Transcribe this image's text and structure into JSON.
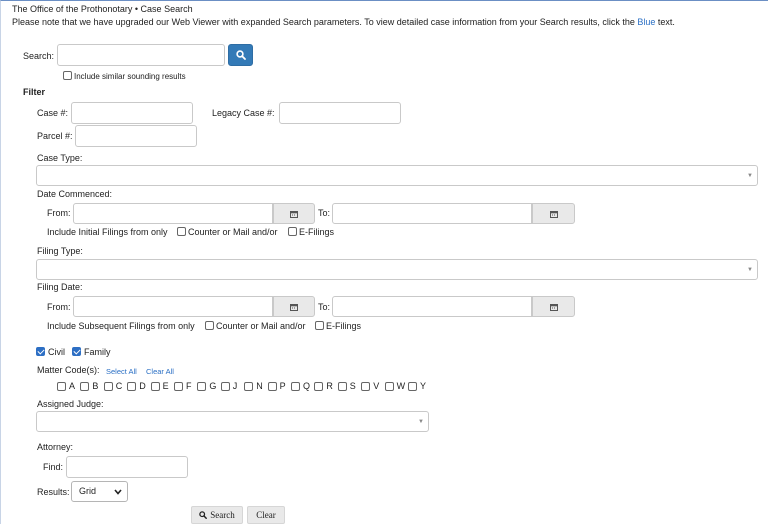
{
  "header": {
    "title": "The Office of the Prothonotary • Case Search",
    "notice_prefix": "Please note that we have upgraded our Web Viewer with expanded Search parameters. To view detailed case information from your Search results, click the ",
    "notice_link": "Blue",
    "notice_suffix": " text."
  },
  "search": {
    "label": "Search:",
    "value": "",
    "similar_label": "Include similar sounding results",
    "similar_checked": false
  },
  "filter": {
    "heading": "Filter",
    "case_no_label": "Case #:",
    "legacy_case_label": "Legacy Case #:",
    "parcel_label": "Parcel #:",
    "case_type_label": "Case Type:",
    "case_type_value": "",
    "date_commenced_label": "Date Commenced:",
    "from_label": "From:",
    "to_label": "To:",
    "initial_filings_label": "Include Initial Filings from only",
    "counter_mail_label": "Counter or Mail and/or",
    "efilings_label": "E-Filings",
    "filing_type_label": "Filing Type:",
    "filing_date_label": "Filing Date:",
    "subsequent_filings_label": "Include Subsequent Filings from only",
    "civil_label": "Civil",
    "civil_checked": true,
    "family_label": "Family",
    "family_checked": true,
    "matter_codes_label": "Matter Code(s):",
    "select_all": "Select All",
    "clear_all": "Clear All",
    "matter_codes": [
      "A",
      "B",
      "C",
      "D",
      "E",
      "F",
      "G",
      "J",
      "N",
      "P",
      "Q",
      "R",
      "S",
      "V",
      "W",
      "Y"
    ],
    "assigned_judge_label": "Assigned Judge:",
    "attorney_label": "Attorney:",
    "find_label": "Find:",
    "results_label": "Results:",
    "results_value": "Grid"
  },
  "actions": {
    "search_label": "Search",
    "clear_label": "Clear"
  },
  "colors": {
    "accent": "#337ab7",
    "link": "#2a6fc4",
    "checkbox_on": "#2d6fc4"
  },
  "icons": {
    "search": "magnifier-icon",
    "calendar": "calendar-icon",
    "dropdown": "chevron-down-icon"
  }
}
